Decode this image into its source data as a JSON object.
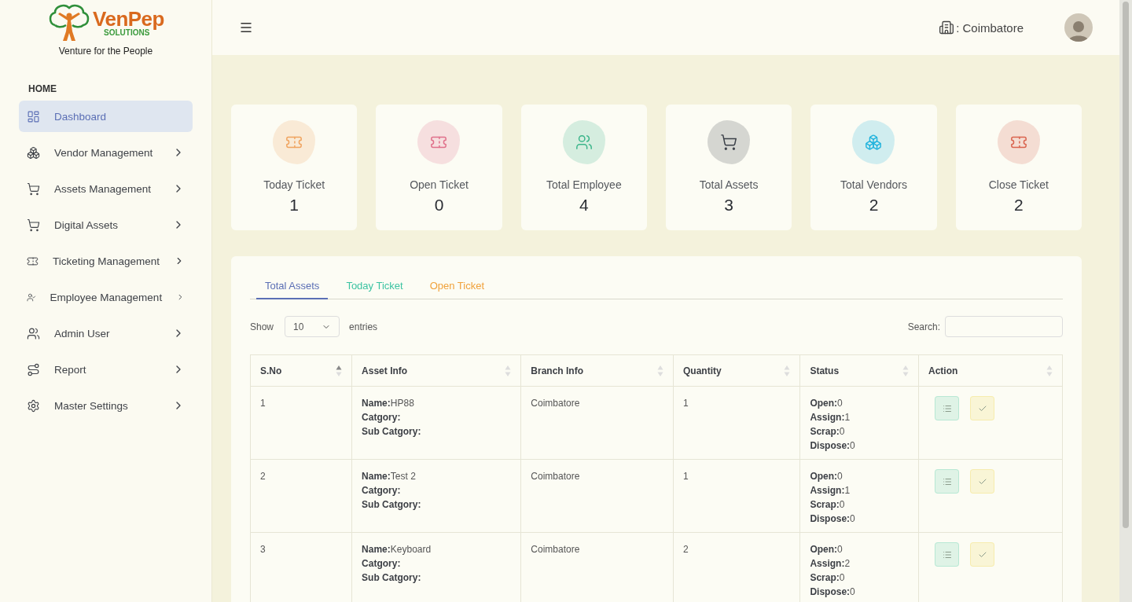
{
  "brand": {
    "name": "VenPep",
    "sub": "SOLUTIONS",
    "tagline": "Venture for the People"
  },
  "header": {
    "location": ": Coimbatore"
  },
  "sidebar": {
    "section": "HOME",
    "items": [
      {
        "label": "Dashboard",
        "kind": "dashboard",
        "selected": true,
        "has_children": false
      },
      {
        "label": "Vendor Management",
        "kind": "boxes",
        "selected": false,
        "has_children": true
      },
      {
        "label": "Assets Management",
        "kind": "cart",
        "selected": false,
        "has_children": true
      },
      {
        "label": "Digital Assets",
        "kind": "cart",
        "selected": false,
        "has_children": true
      },
      {
        "label": "Ticketing Management",
        "kind": "ticket",
        "selected": false,
        "has_children": true
      },
      {
        "label": "Employee Management",
        "kind": "user-star",
        "selected": false,
        "has_children": true
      },
      {
        "label": "Admin User",
        "kind": "users",
        "selected": false,
        "has_children": true
      },
      {
        "label": "Report",
        "kind": "route",
        "selected": false,
        "has_children": true
      },
      {
        "label": "Master Settings",
        "kind": "settings",
        "selected": false,
        "has_children": true
      }
    ]
  },
  "stats": [
    {
      "label": "Today Ticket",
      "value": "1",
      "kind": "ticket",
      "color": "#f0a35e"
    },
    {
      "label": "Open Ticket",
      "value": "0",
      "kind": "ticket",
      "color": "#e0708a"
    },
    {
      "label": "Total Employee",
      "value": "4",
      "kind": "users",
      "color": "#3bb58a"
    },
    {
      "label": "Total Assets",
      "value": "3",
      "kind": "cart",
      "color": "#3b4048"
    },
    {
      "label": "Total Vendors",
      "value": "2",
      "kind": "boxes",
      "color": "#22b3dd"
    },
    {
      "label": "Close Ticket",
      "value": "2",
      "kind": "ticket",
      "color": "#d9634e"
    }
  ],
  "tabs": [
    {
      "label": "Total Assets",
      "selected": true,
      "color": "#5b6fb5"
    },
    {
      "label": "Today Ticket",
      "selected": false,
      "color": "#3cc3a2"
    },
    {
      "label": "Open Ticket",
      "selected": false,
      "color": "#f0a23c"
    }
  ],
  "table_controls": {
    "show_label": "Show",
    "page_size": "10",
    "entries_label": "entries",
    "search_label": "Search:"
  },
  "table": {
    "columns": [
      {
        "label": "S.No",
        "sorted": true
      },
      {
        "label": "Asset Info",
        "sorted": false
      },
      {
        "label": "Branch Info",
        "sorted": false
      },
      {
        "label": "Quantity",
        "sorted": false
      },
      {
        "label": "Status",
        "sorted": false
      },
      {
        "label": "Action",
        "sorted": false
      }
    ],
    "rows": [
      {
        "sno": "1",
        "asset_info": [
          {
            "label": "Name:",
            "value": "HP88"
          },
          {
            "label": "Catgory:"
          },
          {
            "label": "Sub Catgory:"
          }
        ],
        "branch": "Coimbatore",
        "quantity": "1",
        "status": [
          {
            "label": "Open:",
            "value": "0"
          },
          {
            "label": "Assign:",
            "value": "1"
          },
          {
            "label": "Scrap:",
            "value": "0"
          },
          {
            "label": "Dispose:",
            "value": "0"
          }
        ]
      },
      {
        "sno": "2",
        "asset_info": [
          {
            "label": "Name:",
            "value": "Test 2"
          },
          {
            "label": "Catgory:"
          },
          {
            "label": "Sub Catgory:"
          }
        ],
        "branch": "Coimbatore",
        "quantity": "1",
        "status": [
          {
            "label": "Open:",
            "value": "0"
          },
          {
            "label": "Assign:",
            "value": "1"
          },
          {
            "label": "Scrap:",
            "value": "0"
          },
          {
            "label": "Dispose:",
            "value": "0"
          }
        ]
      },
      {
        "sno": "3",
        "asset_info": [
          {
            "label": "Name:",
            "value": "Keyboard"
          },
          {
            "label": "Catgory:"
          },
          {
            "label": "Sub Catgory:"
          }
        ],
        "branch": "Coimbatore",
        "quantity": "2",
        "status": [
          {
            "label": "Open:",
            "value": "0"
          },
          {
            "label": "Assign:",
            "value": "2"
          },
          {
            "label": "Scrap:",
            "value": "0"
          },
          {
            "label": "Dispose:",
            "value": "0"
          }
        ]
      }
    ]
  }
}
